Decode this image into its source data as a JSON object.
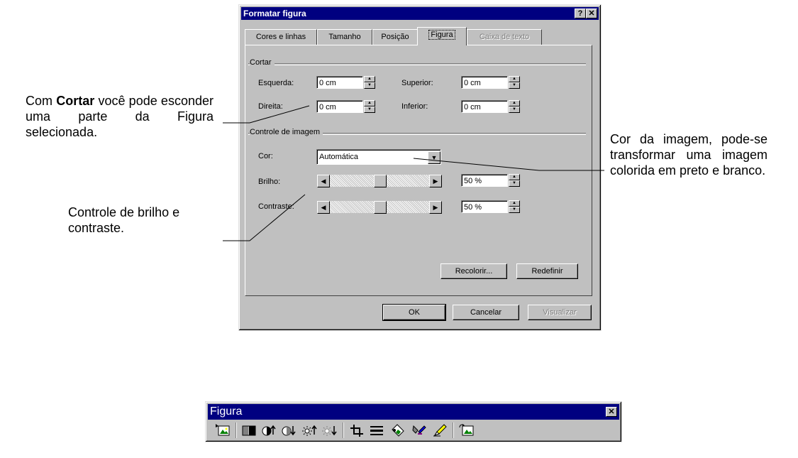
{
  "annotations": {
    "cortar_pre": "Com ",
    "cortar_bold": "Cortar",
    "cortar_post": " você pode esconder uma parte da Figura selecionada.",
    "brilho": "Controle de brilho e contraste.",
    "cor": "Cor da imagem, pode-se transformar uma imagem colorida em preto e branco."
  },
  "dialog": {
    "title": "Formatar figura",
    "help_button": "?",
    "close_button": "✕",
    "tabs": [
      "Cores e linhas",
      "Tamanho",
      "Posição",
      "Figura",
      "Caixa de texto"
    ],
    "active_tab": "Figura",
    "crop": {
      "group_label": "Cortar",
      "left_label": "Esquerda:",
      "left_value": "0 cm",
      "top_label": "Superior:",
      "top_value": "0 cm",
      "right_label": "Direita:",
      "right_value": "0 cm",
      "bottom_label": "Inferior:",
      "bottom_value": "0 cm"
    },
    "image_control": {
      "group_label": "Controle de imagem",
      "color_label": "Cor:",
      "color_value": "Automática",
      "brightness_label": "Brilho:",
      "brightness_value": "50 %",
      "brightness_level": 0.5,
      "contrast_label": "Contraste:",
      "contrast_value": "50 %",
      "contrast_level": 0.5
    },
    "recolor_button": "Recolorir...",
    "reset_button": "Redefinir",
    "ok_button": "OK",
    "cancel_button": "Cancelar",
    "preview_button": "Visualizar"
  },
  "toolbar": {
    "title": "Figura",
    "close_button": "✕",
    "icons": [
      "insert-picture-icon",
      "image-control-icon",
      "more-contrast-icon",
      "less-contrast-icon",
      "more-brightness-icon",
      "less-brightness-icon",
      "crop-icon",
      "line-style-icon",
      "format-picture-icon",
      "set-transparent-color-icon",
      "reset-picture-icon"
    ]
  }
}
